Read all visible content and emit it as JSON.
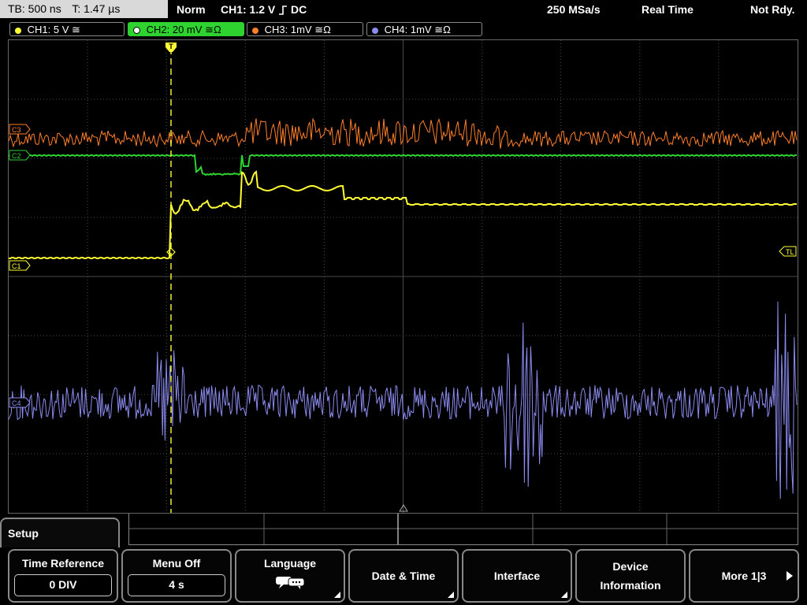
{
  "status": {
    "timebase": "TB: 500 ns",
    "trigger_time": "T: 1.47 µs",
    "mode": "Norm",
    "trigger_source": "CH1: 1.2 V",
    "trigger_coupling": "DC",
    "sample_rate": "250 MSa/s",
    "acq_mode": "Real Time",
    "ready_state": "Not Rdy."
  },
  "channels": [
    {
      "label": "CH1: 5 V",
      "coupling_sym": "≅",
      "color": "#ffff33",
      "active": false
    },
    {
      "label": "CH2: 20 mV",
      "coupling_sym": "≅Ω",
      "color": "#2fd32f",
      "active": true
    },
    {
      "label": "CH3: 1mV",
      "coupling_sym": "≅Ω",
      "color": "#ff7f2a",
      "active": false
    },
    {
      "label": "CH4: 1mV",
      "coupling_sym": "≅Ω",
      "color": "#8b8bf0",
      "active": false
    }
  ],
  "markers": {
    "trigger_level": "TL",
    "ch1": "C1",
    "ch2": "C2",
    "ch3": "C3",
    "ch4": "C4"
  },
  "menu": {
    "title": "Setup",
    "time_reference": {
      "label": "Time Reference",
      "value": "0 DIV"
    },
    "menu_off": {
      "label": "Menu Off",
      "value": "4 s"
    },
    "language": {
      "label": "Language"
    },
    "date_time": {
      "label": "Date & Time"
    },
    "interface": {
      "label": "Interface"
    },
    "device_info": {
      "label1": "Device",
      "label2": "Information"
    },
    "more": {
      "label": "More 1|3"
    }
  },
  "icons": [
    "trigger-position-icon",
    "trigger-level-icon",
    "speech-bubble-icon",
    "submenu-corner-icon",
    "arrow-right-icon"
  ],
  "colors": {
    "ch1": "#ffff33",
    "ch2": "#2fd32f",
    "ch3": "#ff7f2a",
    "ch4": "#8b8bf0",
    "grid": "#4a4a4a",
    "trigger": "#ffff33"
  }
}
